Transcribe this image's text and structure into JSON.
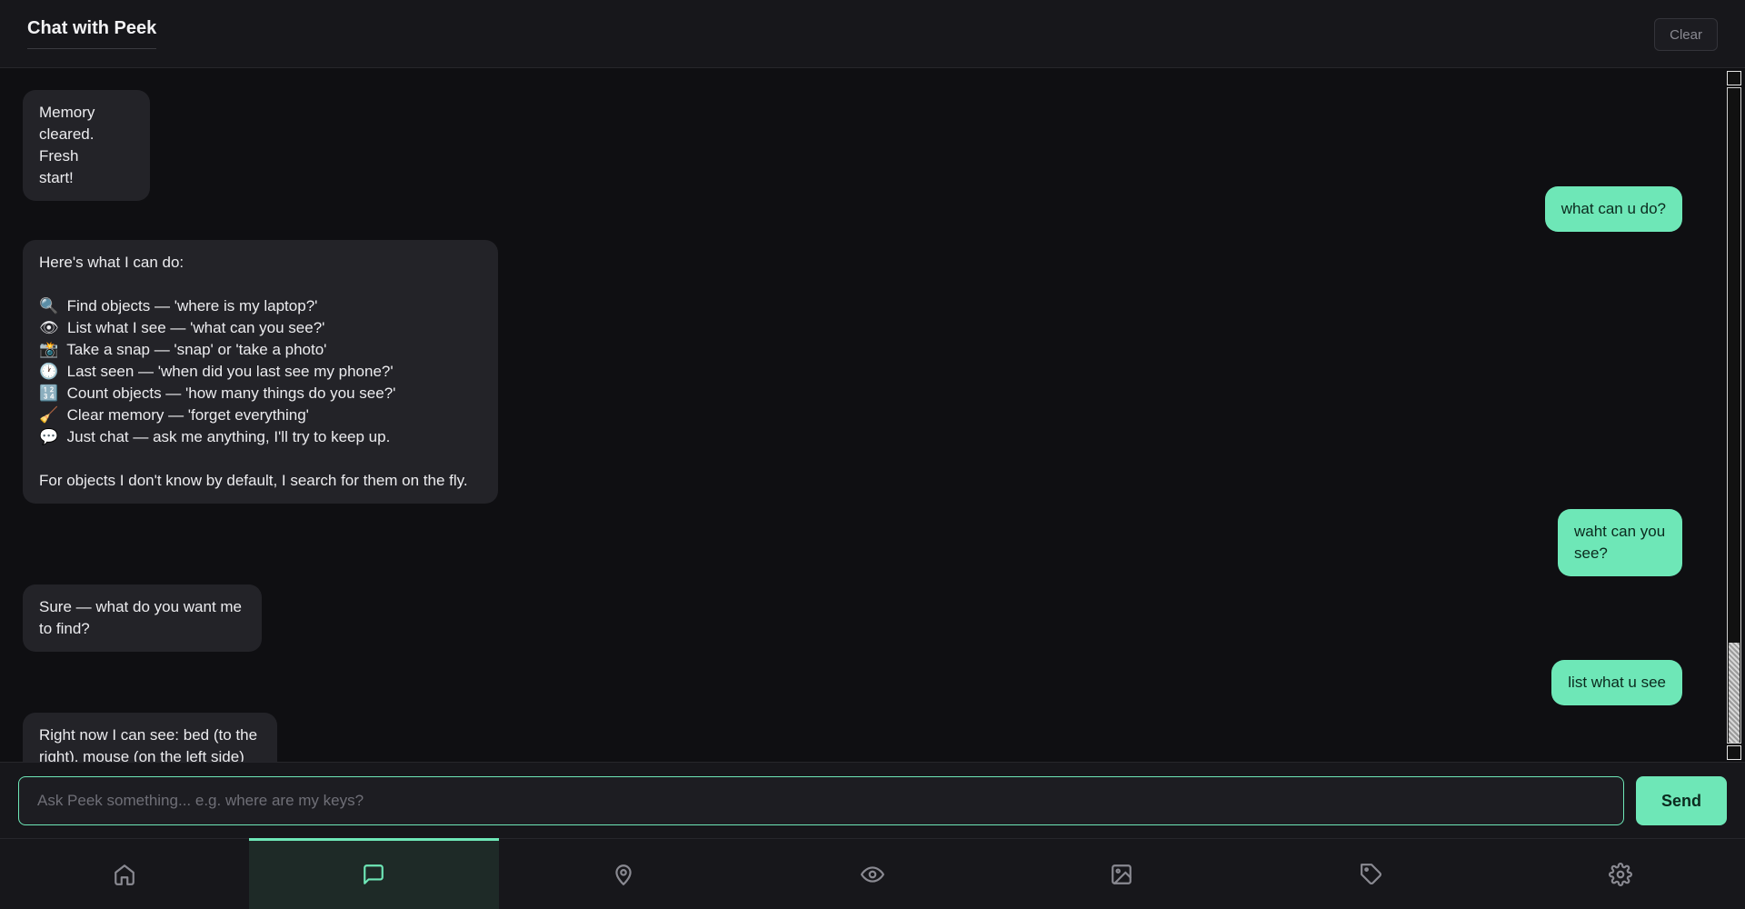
{
  "header": {
    "title": "Chat with Peek",
    "clear_label": "Clear"
  },
  "messages": [
    {
      "role": "bot",
      "text": "Memory\ncleared. Fresh\nstart!"
    },
    {
      "role": "user",
      "text": "what can u do?"
    },
    {
      "role": "bot",
      "text": "Here's what I can do:\n\n🔍  Find objects — 'where is my laptop?'\n👁  List what I see — 'what can you see?'\n📸  Take a snap — 'snap' or 'take a photo'\n🕐  Last seen — 'when did you last see my phone?'\n🔢  Count objects — 'how many things do you see?'\n🧹  Clear memory — 'forget everything'\n💬  Just chat — ask me anything, I'll try to keep up.\n\nFor objects I don't know by default, I search for them on the fly."
    },
    {
      "role": "user",
      "text": "waht can you\nsee?"
    },
    {
      "role": "bot",
      "text": "Sure — what do you want me\nto find?"
    },
    {
      "role": "user",
      "text": "list what u see"
    },
    {
      "role": "bot",
      "text": "Right now I can see: bed (to the\nright), mouse (on the left side)"
    }
  ],
  "composer": {
    "placeholder": "Ask Peek something... e.g. where are my keys?",
    "value": "",
    "send_label": "Send"
  },
  "nav": {
    "items": [
      {
        "icon": "home-icon",
        "active": false
      },
      {
        "icon": "chat-icon",
        "active": true
      },
      {
        "icon": "map-pin-icon",
        "active": false
      },
      {
        "icon": "eye-icon",
        "active": false
      },
      {
        "icon": "image-icon",
        "active": false
      },
      {
        "icon": "tag-icon",
        "active": false
      },
      {
        "icon": "gear-icon",
        "active": false
      }
    ]
  },
  "colors": {
    "accent": "#6ee7b7",
    "background": "#0f0f12",
    "bubble_bot": "#232328"
  }
}
